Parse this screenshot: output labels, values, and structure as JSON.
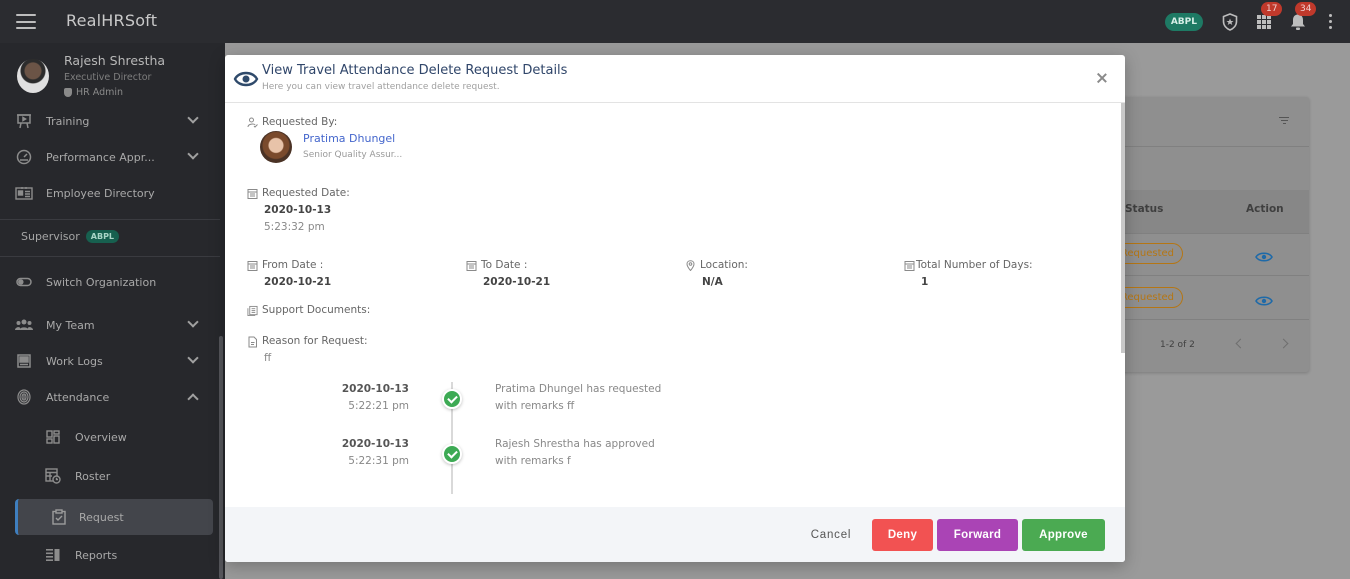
{
  "topbar": {
    "brand": "RealHRSoft",
    "org_badge": "ABPL",
    "apps_badge": "17",
    "notifications_badge": "34"
  },
  "sidebar": {
    "profile": {
      "name": "Rajesh Shrestha",
      "role": "Executive Director",
      "admin_label": "HR Admin"
    },
    "items": [
      {
        "label": "Training",
        "icon": "training-board-icon",
        "chevron": "down"
      },
      {
        "label": "Performance Appr...",
        "icon": "gauge-icon",
        "chevron": "down"
      },
      {
        "label": "Employee Directory",
        "icon": "id-card-icon"
      }
    ],
    "supervisor": {
      "label": "Supervisor",
      "badge": "ABPL"
    },
    "items2": [
      {
        "label": "Switch Organization",
        "icon": "toggle-icon"
      },
      {
        "label": "My Team",
        "icon": "team-icon",
        "chevron": "down"
      },
      {
        "label": "Work Logs",
        "icon": "worklog-icon",
        "chevron": "down"
      },
      {
        "label": "Attendance",
        "icon": "fingerprint-icon",
        "chevron": "up"
      }
    ],
    "sub_items": [
      {
        "label": "Overview",
        "icon": "dashboard-icon"
      },
      {
        "label": "Roster",
        "icon": "roster-clock-icon"
      },
      {
        "label": "Request",
        "icon": "clipboard-check-icon",
        "active": true
      },
      {
        "label": "Reports",
        "icon": "reports-icon"
      }
    ]
  },
  "background_table": {
    "columns": [
      "Status",
      "Action"
    ],
    "rows": [
      {
        "status": "Requested"
      },
      {
        "status": "Requested"
      }
    ],
    "pagination": "1-2 of 2"
  },
  "modal": {
    "title": "View Travel Attendance Delete Request Details",
    "subtitle": "Here you can view travel attendance delete request.",
    "requested_by_label": "Requested By:",
    "requester": {
      "name": "Pratima Dhungel",
      "title": "Senior Quality Assur..."
    },
    "requested_date_label": "Requested Date:",
    "requested_date": "2020-10-13",
    "requested_time": "5:23:32 pm",
    "from_date_label": "From Date :",
    "from_date": "2020-10-21",
    "to_date_label": "To Date :",
    "to_date": "2020-10-21",
    "location_label": "Location:",
    "location": "N/A",
    "total_days_label": "Total Number of Days:",
    "total_days": "1",
    "support_documents_label": "Support Documents:",
    "reason_label": "Reason for Request:",
    "reason": "ff",
    "timeline": [
      {
        "date": "2020-10-13",
        "time": "5:22:21 pm",
        "text": "Pratima Dhungel has requested with remarks ff"
      },
      {
        "date": "2020-10-13",
        "time": "5:22:31 pm",
        "text": "Rajesh Shrestha has approved with remarks f"
      }
    ],
    "buttons": {
      "cancel": "Cancel",
      "deny": "Deny",
      "forward": "Forward",
      "approve": "Approve"
    },
    "colors": {
      "deny": "#f25252",
      "forward": "#aa44b5",
      "approve": "#4baa52",
      "link": "#4466cc"
    }
  }
}
